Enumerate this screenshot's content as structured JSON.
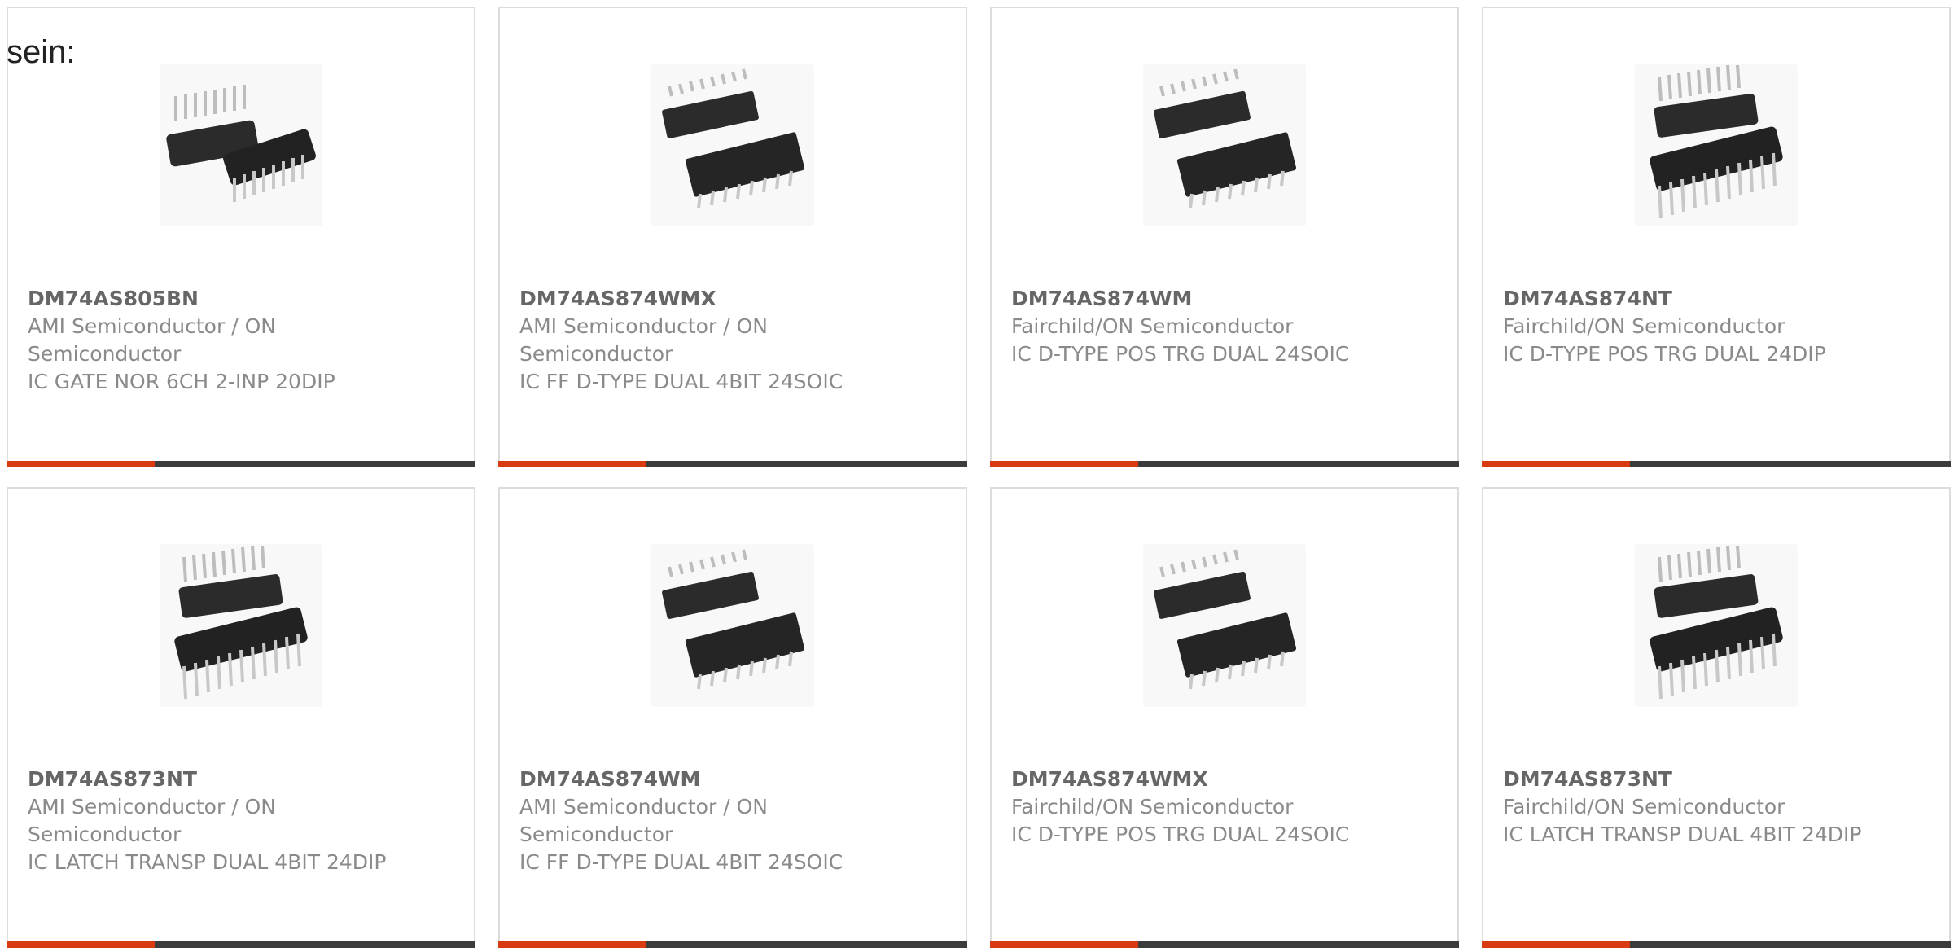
{
  "lead_text": "sein:",
  "colors": {
    "accent": "#d83b10",
    "bar": "#3c3c3c",
    "border": "#dcdcdc",
    "part_number": "#666666",
    "body_text": "#8a8a8a"
  },
  "products": [
    {
      "part": "DM74AS805BN",
      "manufacturer": "AMI Semiconductor / ON Semiconductor",
      "description": "IC GATE NOR 6CH 2-INP 20DIP",
      "image_icon": "dip-chip-icon"
    },
    {
      "part": "DM74AS874WMX",
      "manufacturer": "AMI Semiconductor / ON Semiconductor",
      "description": "IC FF D-TYPE DUAL 4BIT 24SOIC",
      "image_icon": "soic-chip-icon"
    },
    {
      "part": "DM74AS874WM",
      "manufacturer": "Fairchild/ON Semiconductor",
      "description": "IC D-TYPE POS TRG DUAL 24SOIC",
      "image_icon": "soic-chip-icon"
    },
    {
      "part": "DM74AS874NT",
      "manufacturer": "Fairchild/ON Semiconductor",
      "description": "IC D-TYPE POS TRG DUAL 24DIP",
      "image_icon": "dip-chip-icon"
    },
    {
      "part": "DM74AS873NT",
      "manufacturer": "AMI Semiconductor / ON Semiconductor",
      "description": "IC LATCH TRANSP DUAL 4BIT 24DIP",
      "image_icon": "dip-chip-icon"
    },
    {
      "part": "DM74AS874WM",
      "manufacturer": "AMI Semiconductor / ON Semiconductor",
      "description": "IC FF D-TYPE DUAL 4BIT 24SOIC",
      "image_icon": "soic-chip-icon"
    },
    {
      "part": "DM74AS874WMX",
      "manufacturer": "Fairchild/ON Semiconductor",
      "description": "IC D-TYPE POS TRG DUAL 24SOIC",
      "image_icon": "soic-chip-icon"
    },
    {
      "part": "DM74AS873NT",
      "manufacturer": "Fairchild/ON Semiconductor",
      "description": "IC LATCH TRANSP DUAL 4BIT 24DIP",
      "image_icon": "dip-chip-icon"
    }
  ]
}
